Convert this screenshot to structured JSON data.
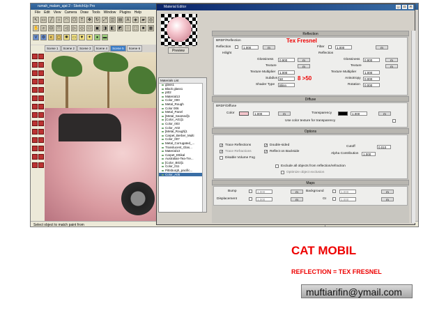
{
  "sketchup": {
    "title": "rumah_malam_ajat 2 - SketchUp Pro",
    "menu": [
      "File",
      "Edit",
      "View",
      "Camera",
      "Draw",
      "Tools",
      "Window",
      "Plugins",
      "Help"
    ],
    "scenes": [
      "Scene 1",
      "Scene 2",
      "Scene 3",
      "Scene 4",
      "Scene 5",
      "Scene 6"
    ],
    "active_scene": "Scene 5",
    "status": "Select object to match paint from",
    "measurements": "Measurements"
  },
  "material_editor": {
    "title": "Material Editor",
    "preview_button": "Preview",
    "list_title": "Materials List",
    "materials": [
      "glass1",
      "Black glass1",
      "pt02",
      "Material13",
      "Color_000",
      "Metal_Rough",
      "Color 006",
      "Metal_Panel",
      "[Metal_Seamed]1",
      "[Color_A01]1",
      "Color_003",
      "Color_A02",
      "[Metal_Rough]1",
      "Carpet_Berber_Multi",
      "Color_007",
      "Metal_Corrugated_...",
      "Translucent_Glas...",
      "Material13",
      "Carpet_Ettikal",
      "Australian-Tea-Tre...",
      "[Color_B03]1",
      "Color_011",
      "Pittsburgh_pacific...",
      "Color_A05"
    ],
    "selected_material": "Color_A05",
    "reflection": {
      "header": "Reflection",
      "brdf_label": "BRDF/Reflection",
      "reflection_label": "Reflection",
      "reflection_value": "1.000",
      "reflection_btn": "m",
      "filter_label": "Filter",
      "filter_value": "1.000",
      "filter_btn": "m",
      "highlight_label": "Hilight",
      "reflection_sub": "Reflection",
      "gloss1_label": "Glossiness",
      "gloss1_value": "0.900",
      "gloss1_btn": "m",
      "gloss2_label": "Glossiness",
      "gloss2_value": "0.900",
      "gloss2_btn": "m",
      "tex1_label": "Texture",
      "tex1_btn": "m",
      "tex2_label": "Texture",
      "tex2_btn": "m",
      "texmult1_label": "Texture Multiplier",
      "texmult1_value": "1.000",
      "texmult2_label": "Texture Multiplier",
      "texmult2_value": "1.000",
      "subdivs_label": "Subdivs",
      "subdivs_value": "50",
      "aniso_label": "Anisotropy",
      "aniso_value": "0.000",
      "shader_label": "Shader Type",
      "shader_value": "Blinn",
      "rotation_label": "Rotation",
      "rotation_value": "0.000"
    },
    "annotations": {
      "tex_fresnel": "Tex Fresnel",
      "subdivs_note": "8 >50"
    },
    "diffuse": {
      "header": "Diffuse",
      "brdf_label": "BRDF/Diffuse",
      "color_label": "Color",
      "color_value": "1.000",
      "color_btn": "m",
      "transparency_label": "Transparency",
      "transparency_value": "1.000",
      "transparency_btn": "m",
      "use_color_label": "Use color texture for transparency"
    },
    "options": {
      "header": "Options",
      "trace_refl": "Trace Reflections",
      "double_sided": "Double-sided",
      "cutoff_label": "Cutoff",
      "cutoff_value": "0.010",
      "trace_refr": "Trace Refractions",
      "reflect_backside": "Reflect on Backside",
      "alpha_label": "Alpha Contribution",
      "alpha_value": "1.000",
      "disable_fog": "Disable Volume Fog",
      "exclude_all": "Exclude all objects from reflection/refraction",
      "optimize_excl": "Optimize object exclusion"
    },
    "maps": {
      "header": "Maps",
      "bump_label": "Bump",
      "bump_value": "1.000",
      "bump_btn": "m",
      "background_label": "Background",
      "background_value": "1.000",
      "background_btn": "m",
      "displacement_label": "Displacement",
      "displacement_value": "1.000",
      "displacement_btn": "m",
      "gi_label": "GI",
      "gi_value": "1.000",
      "gi_btn": "m"
    },
    "colors": {
      "diffuse_swatch": "#f4c6cc",
      "transparency_swatch": "#000000"
    }
  },
  "captions": {
    "heading": "CAT MOBIL",
    "subheading": "REFLECTION = TEX FRESNEL",
    "email": "muftiarifin@ymail.com"
  }
}
